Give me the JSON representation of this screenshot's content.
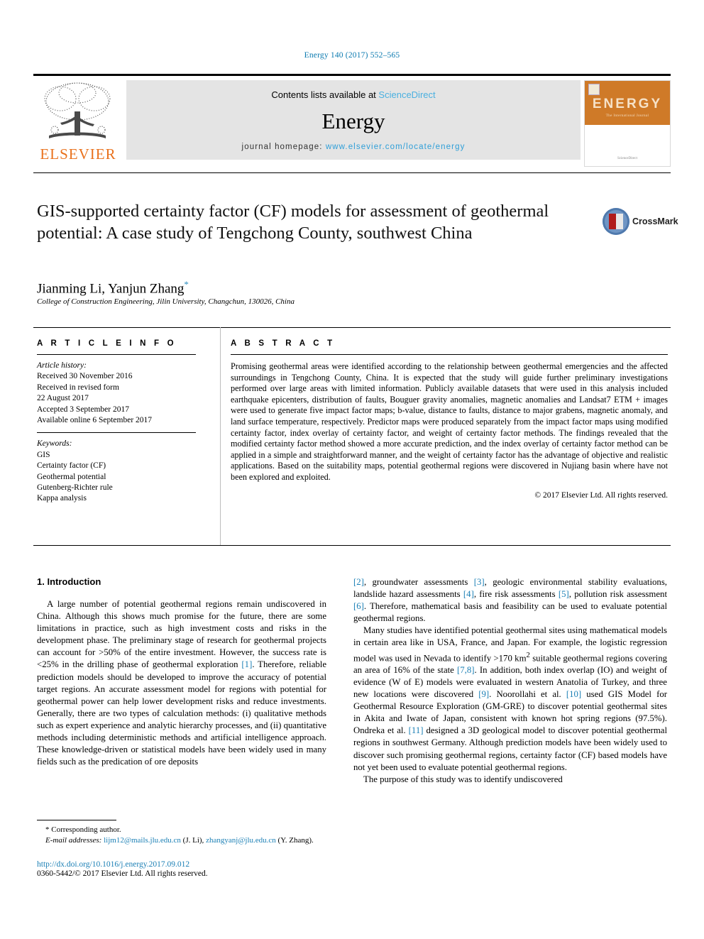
{
  "running_head": "Energy 140 (2017) 552–565",
  "masthead": {
    "publisher_name": "ELSEVIER",
    "contents_prefix": "Contents lists available at",
    "sciencedirect": "ScienceDirect",
    "journal_name": "Energy",
    "homepage_label": "journal homepage:",
    "homepage_url": "www.elsevier.com/locate/energy",
    "cover_title": "ENERGY",
    "cover_subtitle": "The International Journal",
    "cover_footer": "ScienceDirect"
  },
  "article": {
    "title_line1": "GIS-supported certainty factor (CF) models for assessment of",
    "title_line2": "geothermal potential: A case study of Tengchong County, southwest",
    "title_line3": "China",
    "authors": "Jianming Li, Yanjun Zhang",
    "corresponding_marker": "*",
    "affiliation": "College of Construction Engineering, Jilin University, Changchun, 130026, China",
    "crossmark_label": "CrossMark"
  },
  "article_info": {
    "heading": "A R T I C L E   I N F O",
    "history_label": "Article history:",
    "history": [
      "Received 30 November 2016",
      "Received in revised form",
      "22 August 2017",
      "Accepted 3 September 2017",
      "Available online 6 September 2017"
    ],
    "keywords_label": "Keywords:",
    "keywords": [
      "GIS",
      "Certainty factor (CF)",
      "Geothermal potential",
      "Gutenberg-Richter rule",
      "Kappa analysis"
    ]
  },
  "abstract": {
    "heading": "A B S T R A C T",
    "text": "Promising geothermal areas were identified according to the relationship between geothermal emergencies and the affected surroundings in Tengchong County, China. It is expected that the study will guide further preliminary investigations performed over large areas with limited information. Publicly available datasets that were used in this analysis included earthquake epicenters, distribution of faults, Bouguer gravity anomalies, magnetic anomalies and Landsat7 ETM + images were used to generate five impact factor maps; b-value, distance to faults, distance to major grabens, magnetic anomaly, and land surface temperature, respectively. Predictor maps were produced separately from the impact factor maps using modified certainty factor, index overlay of certainty factor, and weight of certainty factor methods. The findings revealed that the modified certainty factor method showed a more accurate prediction, and the index overlay of certainty factor method can be applied in a simple and straightforward manner, and the weight of certainty factor has the advantage of objective and realistic applications. Based on the suitability maps, potential geothermal regions were discovered in Nujiang basin where have not been explored and exploited.",
    "copyright": "© 2017 Elsevier Ltd. All rights reserved."
  },
  "body": {
    "section_number_title": "1.  Introduction",
    "left_paragraph_1_a": "A large number of potential geothermal regions remain undiscovered in China. Although this shows much promise for the future, there are some limitations in practice, such as high investment costs and risks in the development phase. The preliminary stage of research for geothermal projects can account for >50% of the entire investment. However, the success rate is <25% in the drilling phase of geothermal exploration ",
    "left_cite_1": "[1]",
    "left_paragraph_1_b": ". Therefore, reliable prediction models should be developed to improve the accuracy of potential target regions. An accurate assessment model for regions with potential for geothermal power can help lower development risks and reduce investments. Generally, there are two types of calculation methods: (i) qualitative methods such as expert experience and analytic hierarchy processes, and (ii) quantitative methods including deterministic methods and artificial intelligence approach. These knowledge-driven or statistical models have been widely used in many fields such as the predication of ore deposits",
    "right_cite_2": "[2]",
    "right_seg_a": ", groundwater assessments ",
    "right_cite_3": "[3]",
    "right_seg_b": ", geologic environmental stability evaluations, landslide hazard assessments ",
    "right_cite_4": "[4]",
    "right_seg_c": ", fire risk assessments ",
    "right_cite_5": "[5]",
    "right_seg_d": ", pollution risk assessment ",
    "right_cite_6": "[6]",
    "right_seg_e": ". Therefore, mathematical basis and feasibility can be used to evaluate potential geothermal regions.",
    "right_paragraph_2_a": "Many studies have identified potential geothermal sites using mathematical models in certain area like in USA, France, and Japan. For example, the logistic regression model was used in Nevada to identify >170 km",
    "right_superscript_2": "2",
    "right_paragraph_2_b": " suitable geothermal regions covering an area of 16% of the state ",
    "right_cite_78": "[7,8]",
    "right_paragraph_2_c": ". In addition, both index overlap (IO) and weight of evidence (W of E) models were evaluated in western Anatolia of Turkey, and three new locations were discovered ",
    "right_cite_9": "[9]",
    "right_paragraph_2_d": ". Noorollahi et al. ",
    "right_cite_10": "[10]",
    "right_paragraph_2_e": " used GIS Model for Geothermal Resource Exploration (GM-GRE) to discover potential geothermal sites in Akita and Iwate of Japan, consistent with known hot spring regions (97.5%). Ondreka et al. ",
    "right_cite_11": "[11]",
    "right_paragraph_2_f": " designed a 3D geological model to discover potential geothermal regions in southwest Germany. Although prediction models have been widely used to discover such promising geothermal regions, certainty factor (CF) based models have not yet been used to evaluate potential geothermal regions.",
    "right_paragraph_3": "The purpose of this study was to identify undiscovered"
  },
  "footnote": {
    "corresponding_marker": "*",
    "corresponding_text": "Corresponding author.",
    "email_label": "E-mail addresses:",
    "email_1": "lijm12@mails.jlu.edu.cn",
    "email_1_owner": "(J. Li),",
    "email_2": "zhangyanj@jlu.edu.cn",
    "email_2_owner": "(Y. Zhang)."
  },
  "footer": {
    "doi": "http://dx.doi.org/10.1016/j.energy.2017.09.012",
    "issn_line": "0360-5442/© 2017 Elsevier Ltd. All rights reserved."
  },
  "colors": {
    "link_blue": "#1a7fb5",
    "elsevier_orange": "#E9711C",
    "sciencedirect_blue": "#4ab0e0",
    "cover_orange": "#cf7a28"
  }
}
